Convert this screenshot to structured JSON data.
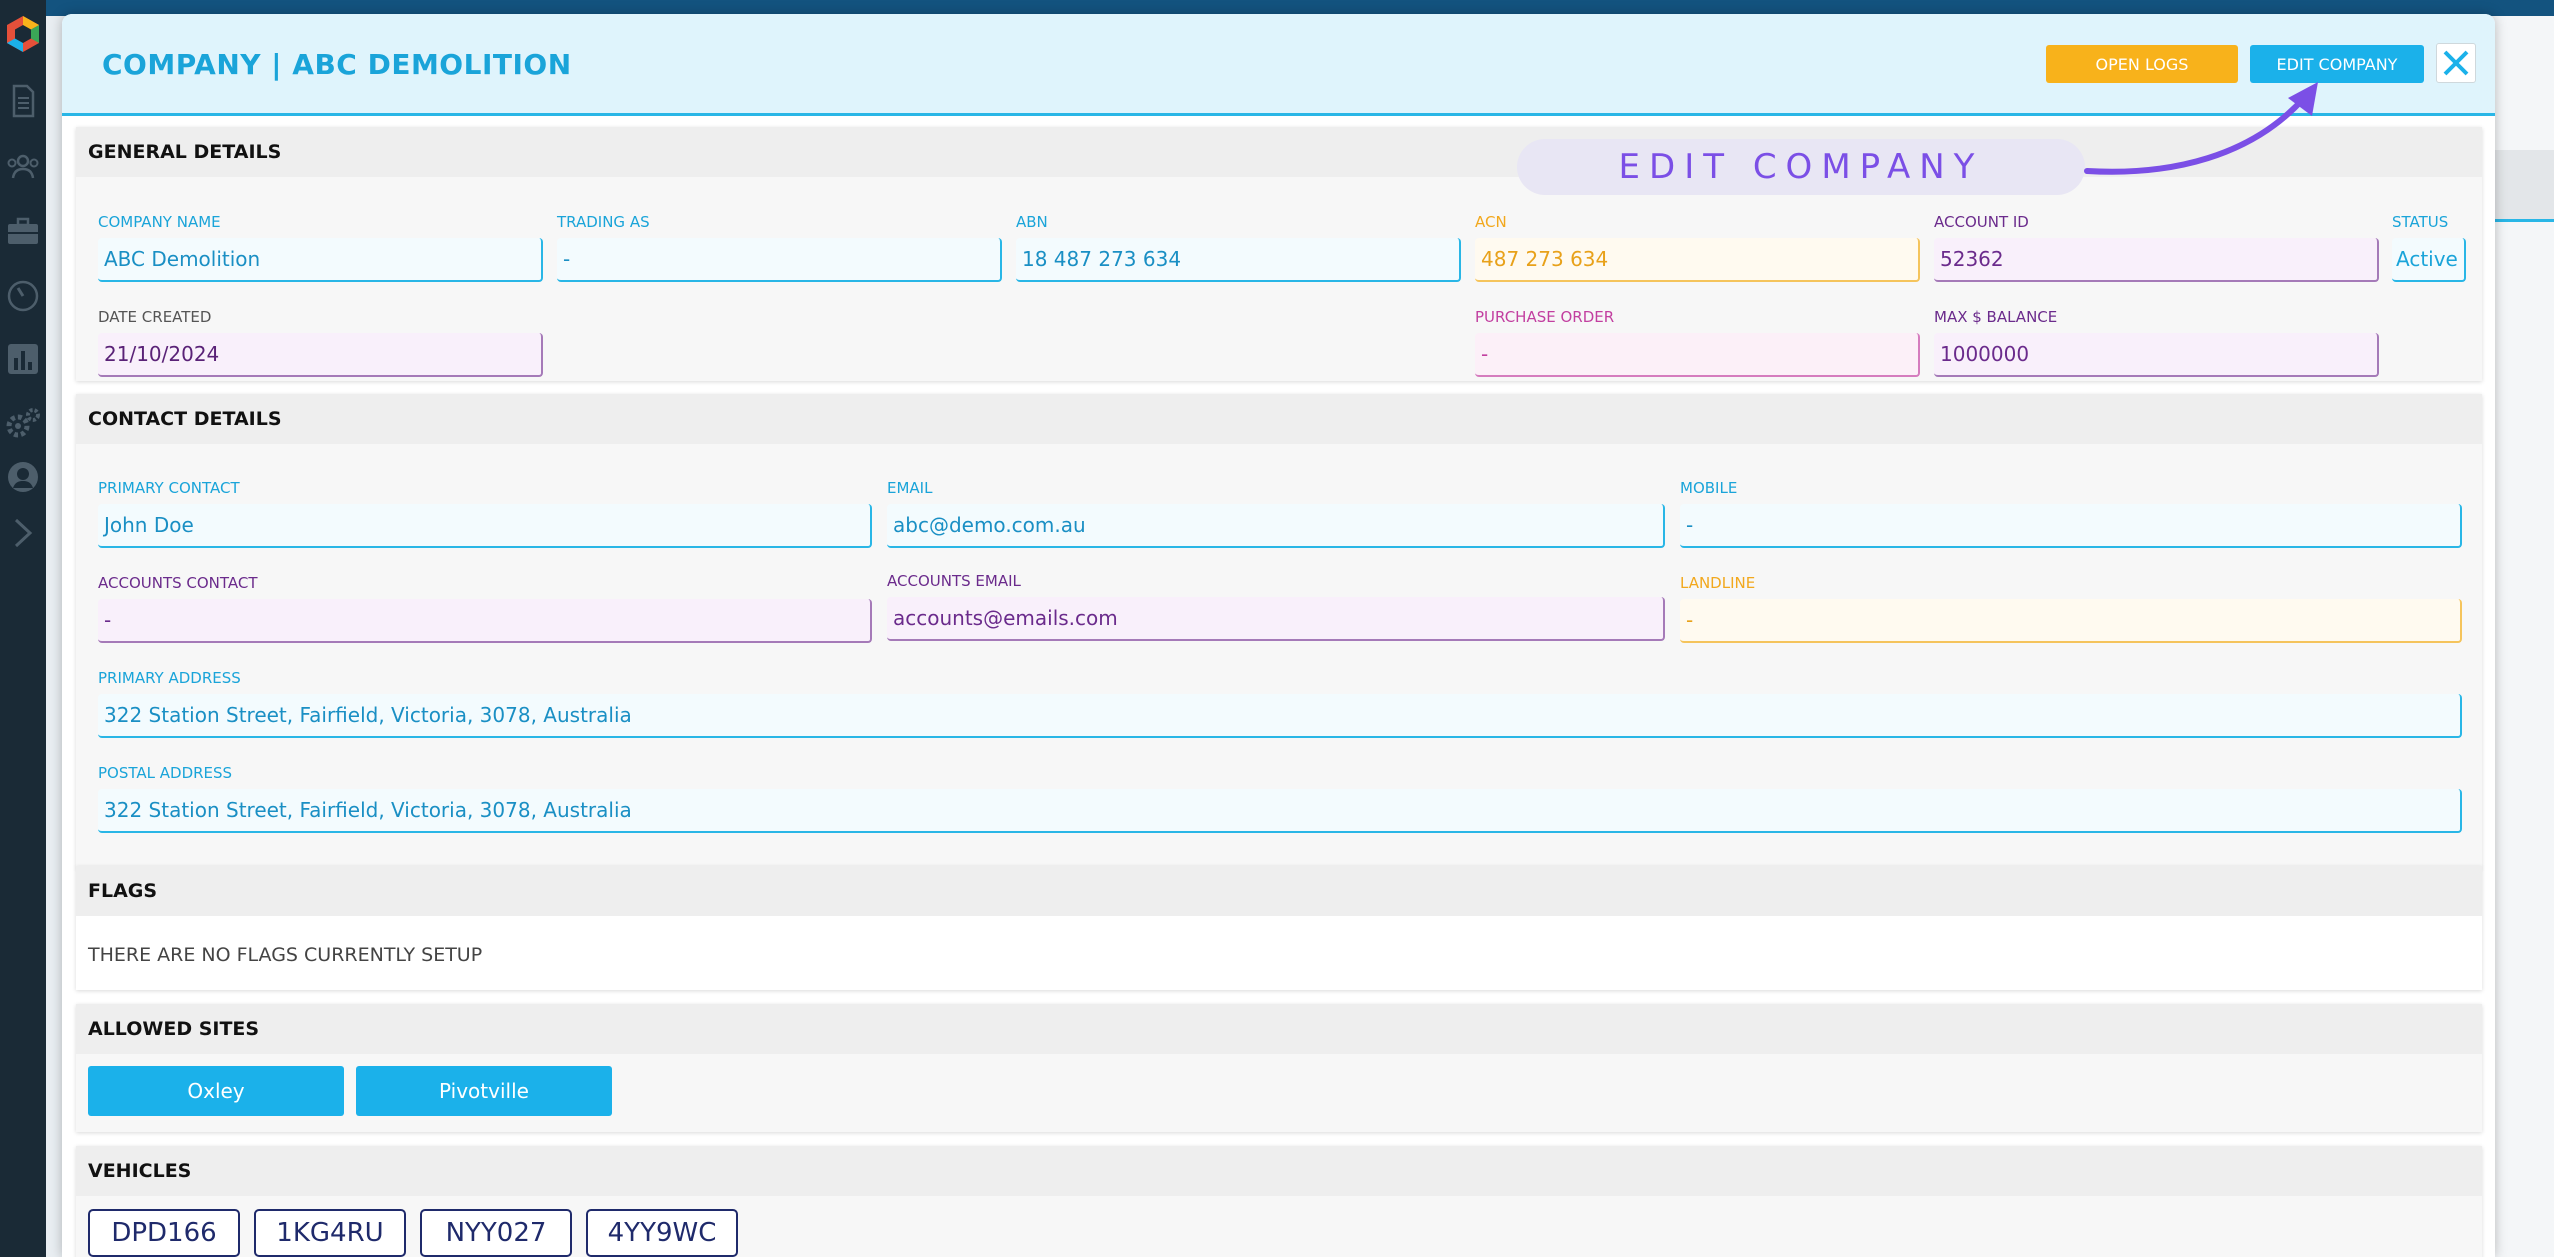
{
  "modal": {
    "title": "COMPANY | ABC DEMOLITION",
    "open_logs_label": "OPEN LOGS",
    "edit_company_label": "EDIT COMPANY"
  },
  "annotation": {
    "text": "EDIT COMPANY"
  },
  "general": {
    "heading": "GENERAL DETAILS",
    "company_name": {
      "label": "COMPANY NAME",
      "value": "ABC Demolition"
    },
    "trading_as": {
      "label": "TRADING AS",
      "value": "-"
    },
    "abn": {
      "label": "ABN",
      "value": "18 487 273 634"
    },
    "acn": {
      "label": "ACN",
      "value": "487 273 634"
    },
    "account_id": {
      "label": "ACCOUNT ID",
      "value": "52362"
    },
    "status": {
      "label": "STATUS",
      "value": "Active"
    },
    "date_created": {
      "label": "DATE CREATED",
      "value": "21/10/2024"
    },
    "purchase_order": {
      "label": "PURCHASE ORDER",
      "value": "-"
    },
    "max_balance": {
      "label": "MAX $ BALANCE",
      "value": "1000000"
    }
  },
  "contact": {
    "heading": "CONTACT DETAILS",
    "primary_contact": {
      "label": "PRIMARY CONTACT",
      "value": "John Doe"
    },
    "email": {
      "label": "EMAIL",
      "value": "abc@demo.com.au"
    },
    "mobile": {
      "label": "MOBILE",
      "value": "-"
    },
    "accounts_contact": {
      "label": "ACCOUNTS CONTACT",
      "value": "-"
    },
    "accounts_email": {
      "label": "ACCOUNTS EMAIL",
      "value": "accounts@emails.com"
    },
    "landline": {
      "label": "LANDLINE",
      "value": "-"
    },
    "primary_address": {
      "label": "PRIMARY ADDRESS",
      "value": "322 Station Street, Fairfield, Victoria, 3078, Australia"
    },
    "postal_address": {
      "label": "POSTAL ADDRESS",
      "value": "322 Station Street, Fairfield, Victoria, 3078, Australia"
    }
  },
  "flags": {
    "heading": "FLAGS",
    "empty_text": "THERE ARE NO FLAGS CURRENTLY SETUP"
  },
  "sites": {
    "heading": "ALLOWED SITES",
    "items": [
      "Oxley",
      "Pivotville"
    ]
  },
  "vehicles": {
    "heading": "VEHICLES",
    "items": [
      "DPD166",
      "1KG4RU",
      "NYY027",
      "4YY9WC"
    ]
  },
  "colors": {
    "accent_blue": "#29b6e6",
    "orange": "#f8b21b",
    "purple": "#6b2b8c",
    "annotation_violet": "#7b4fe6"
  },
  "icons": [
    "app-logo-icon",
    "document-icon",
    "users-icon",
    "briefcase-icon",
    "gauge-icon",
    "chart-icon",
    "gears-icon",
    "support-icon",
    "chevron-right-icon",
    "close-icon"
  ]
}
